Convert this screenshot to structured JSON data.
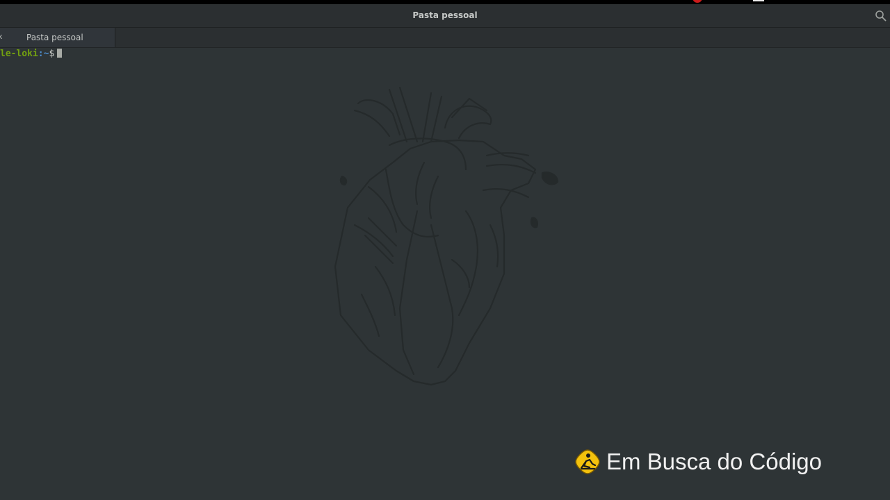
{
  "window": {
    "title": "Pasta pessoal",
    "search_icon": "search-icon"
  },
  "tabs": [
    {
      "label": "Pasta pessoal",
      "close_glyph": "x",
      "active": true
    }
  ],
  "terminal": {
    "host": "le-loki",
    "separator": ":",
    "path": "~",
    "symbol": "$",
    "background_image": "anatomical-heart"
  },
  "watermark": {
    "logo_icon": "em-busca-do-codigo-logo",
    "text": "Em Busca do Código"
  },
  "colors": {
    "background": "#2e3436",
    "host": "#73a110",
    "path": "#4e8fd0",
    "logo_yellow": "#f4c20d"
  }
}
